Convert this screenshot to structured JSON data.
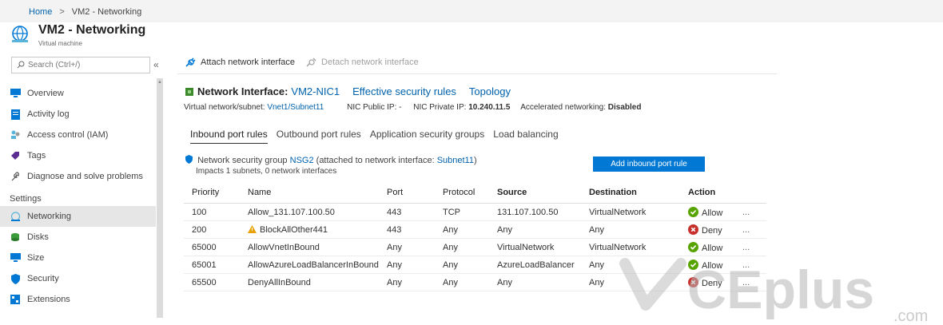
{
  "breadcrumb": {
    "home": "Home",
    "separator": ">",
    "current": "VM2 - Networking"
  },
  "header": {
    "title": "VM2 - Networking",
    "subtitle": "Virtual machine",
    "icon": "network-globe-icon"
  },
  "search": {
    "placeholder": "Search (Ctrl+/)",
    "collapse_label": "«"
  },
  "sidebar": {
    "items": [
      {
        "label": "Overview",
        "icon": "monitor-icon"
      },
      {
        "label": "Activity log",
        "icon": "log-icon"
      },
      {
        "label": "Access control (IAM)",
        "icon": "people-icon"
      },
      {
        "label": "Tags",
        "icon": "tag-icon"
      },
      {
        "label": "Diagnose and solve problems",
        "icon": "wrench-icon"
      }
    ],
    "settings_header": "Settings",
    "settings_items": [
      {
        "label": "Networking",
        "icon": "network-icon",
        "active": true
      },
      {
        "label": "Disks",
        "icon": "disk-icon"
      },
      {
        "label": "Size",
        "icon": "monitor-icon"
      },
      {
        "label": "Security",
        "icon": "shield-icon"
      },
      {
        "label": "Extensions",
        "icon": "extensions-icon"
      }
    ]
  },
  "toolbar": {
    "attach": "Attach network interface",
    "detach": "Detach network interface"
  },
  "nic": {
    "label": "Network Interface:",
    "name": "VM2-NIC1",
    "effective_rules": "Effective security rules",
    "topology": "Topology",
    "vnet_label": "Virtual network/subnet:",
    "vnet_value": "Vnet1/Subnet11",
    "public_ip_label": "NIC Public IP:",
    "public_ip_value": "-",
    "private_ip_label": "NIC Private IP:",
    "private_ip_value": "10.240.11.5",
    "accel_label": "Accelerated networking:",
    "accel_value": "Disabled"
  },
  "tabs": [
    {
      "label": "Inbound port rules",
      "active": true
    },
    {
      "label": "Outbound port rules"
    },
    {
      "label": "Application security groups"
    },
    {
      "label": "Load balancing"
    }
  ],
  "nsg": {
    "prefix": "Network security group",
    "name": "NSG2",
    "attached_text": "(attached to network interface:",
    "subnet": "Subnet11",
    "close_paren": ")",
    "impacts": "Impacts 1 subnets, 0 network interfaces",
    "add_button": "Add inbound port rule"
  },
  "rules": {
    "headers": [
      "Priority",
      "Name",
      "Port",
      "Protocol",
      "Source",
      "Destination",
      "Action"
    ],
    "rows": [
      {
        "priority": "100",
        "name": "Allow_131.107.100.50",
        "warning": false,
        "port": "443",
        "protocol": "TCP",
        "source": "131.107.100.50",
        "destination": "VirtualNetwork",
        "action": "Allow",
        "more": "..."
      },
      {
        "priority": "200",
        "name": "BlockAllOther441",
        "warning": true,
        "port": "443",
        "protocol": "Any",
        "source": "Any",
        "destination": "Any",
        "action": "Deny",
        "more": "..."
      },
      {
        "priority": "65000",
        "name": "AllowVnetInBound",
        "warning": false,
        "port": "Any",
        "protocol": "Any",
        "source": "VirtualNetwork",
        "destination": "VirtualNetwork",
        "action": "Allow",
        "more": "..."
      },
      {
        "priority": "65001",
        "name": "AllowAzureLoadBalancerInBound",
        "warning": false,
        "port": "Any",
        "protocol": "Any",
        "source": "AzureLoadBalancer",
        "destination": "Any",
        "action": "Allow",
        "more": "..."
      },
      {
        "priority": "65500",
        "name": "DenyAllInBound",
        "warning": false,
        "port": "Any",
        "protocol": "Any",
        "source": "Any",
        "destination": "Any",
        "action": "Deny",
        "more": "..."
      }
    ]
  },
  "watermark": {
    "text": "CEplus",
    "suffix": ".com"
  },
  "colors": {
    "link": "#0062ad",
    "primary_button": "#0078d4",
    "allow": "#57a300",
    "deny": "#c8302c",
    "warning": "#e8a100"
  }
}
